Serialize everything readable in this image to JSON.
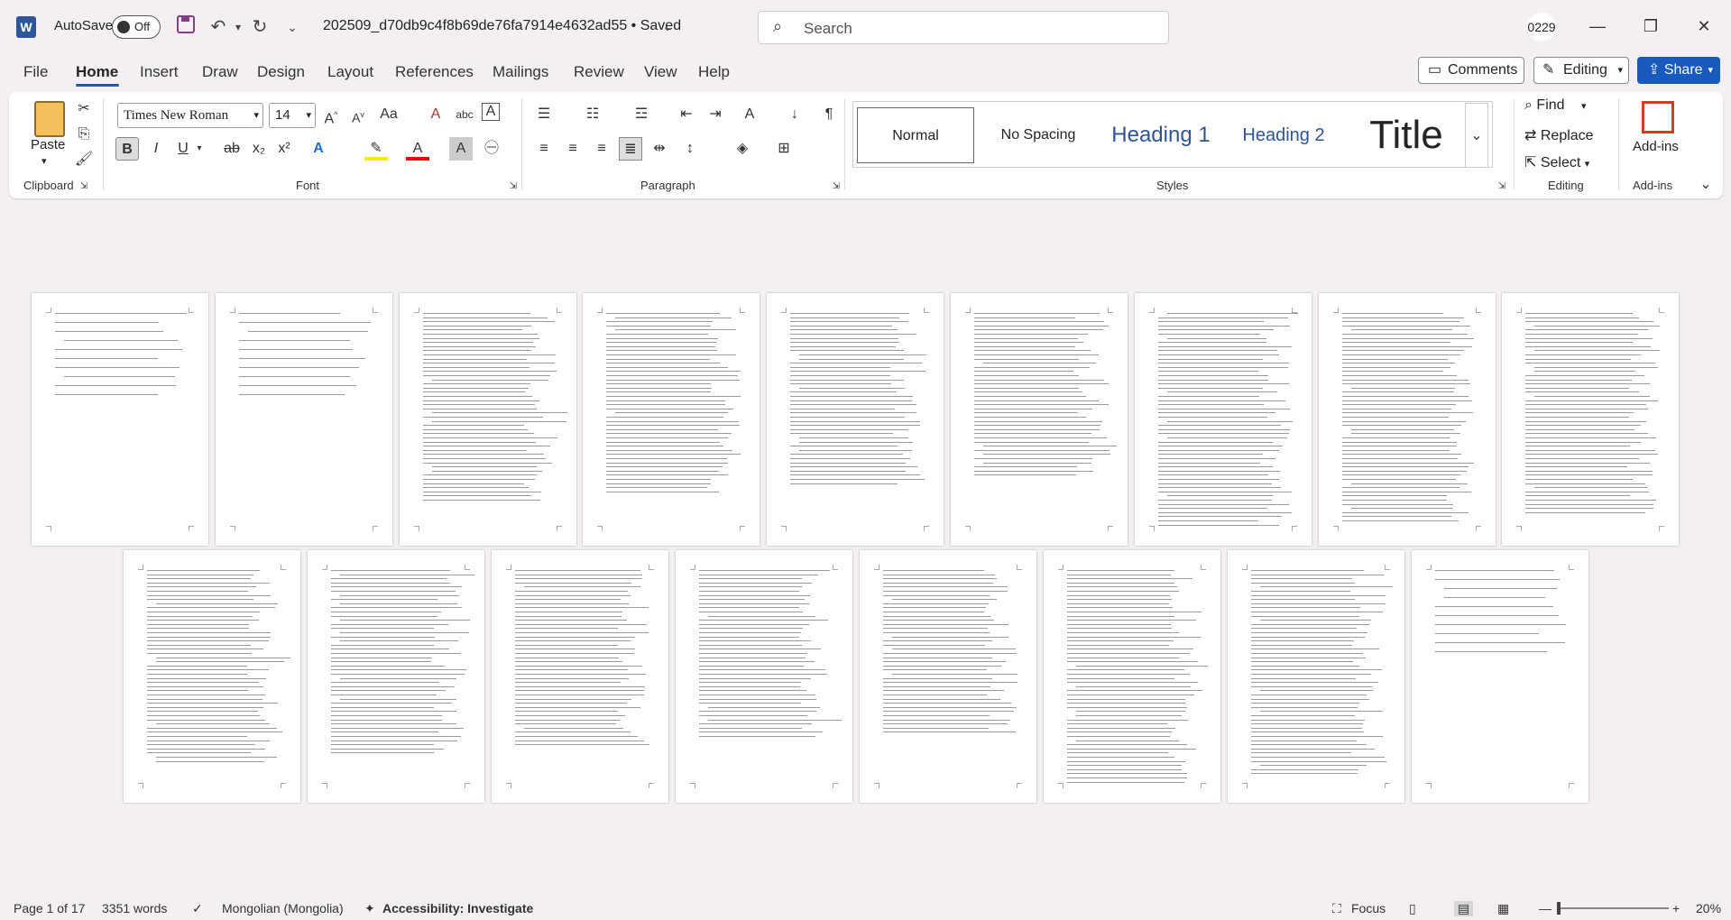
{
  "app": {
    "autosave_label": "AutoSave",
    "autosave_state": "Off",
    "doc_title": "202509_d70db9c4f8b69de76fa7914e4632ad55  •  Saved",
    "search_placeholder": "Search",
    "user_badge": "0229"
  },
  "menu": {
    "tabs": [
      "File",
      "Home",
      "Insert",
      "Draw",
      "Design",
      "Layout",
      "References",
      "Mailings",
      "Review",
      "View",
      "Help"
    ],
    "comments": "Comments",
    "editing": "Editing",
    "share": "Share"
  },
  "ribbon": {
    "clipboard": {
      "paste": "Paste",
      "label": "Clipboard"
    },
    "font": {
      "family": "Times New Roman",
      "size": "14",
      "label": "Font"
    },
    "paragraph": {
      "label": "Paragraph"
    },
    "styles": {
      "label": "Styles",
      "items": [
        "Normal",
        "No Spacing",
        "Heading 1",
        "Heading 2",
        "Title"
      ]
    },
    "editing": {
      "label": "Editing",
      "find": "Find",
      "replace": "Replace",
      "select": "Select"
    },
    "addins": {
      "label": "Add-ins",
      "button": "Add-ins"
    }
  },
  "status": {
    "page": "Page 1 of 17",
    "words": "3351 words",
    "language": "Mongolian (Mongolia)",
    "accessibility": "Accessibility: Investigate",
    "focus": "Focus",
    "zoom": "20%"
  },
  "colors": {
    "accent": "#185abd",
    "word_blue": "#2b579a"
  }
}
